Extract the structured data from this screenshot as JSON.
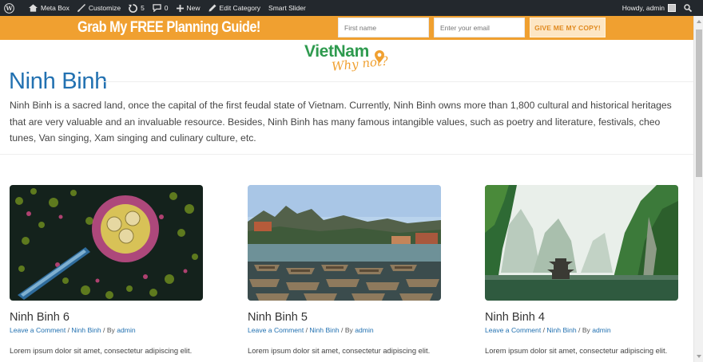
{
  "admin_bar": {
    "site_name": "Meta Box",
    "customize": "Customize",
    "updates_count": "5",
    "comments_count": "0",
    "new": "New",
    "edit_category": "Edit Category",
    "smart_slider": "Smart Slider",
    "howdy": "Howdy, admin"
  },
  "optin": {
    "title": "Grab My FREE Planning Guide!",
    "first_name_placeholder": "First name",
    "email_placeholder": "Enter your email",
    "button_label": "GIVE ME MY COPY!",
    "bg_color": "#f0a030"
  },
  "logo": {
    "main_text": "VietNam",
    "sub_text": "Why not?"
  },
  "category": {
    "title": "Ninh Binh",
    "description": "Ninh Binh is a sacred land, once the capital of the first feudal state of Vietnam. Currently, Ninh Binh owns more than 1,800 cultural and historical heritages that are very valuable and an invaluable resource. Besides, Ninh Binh has many famous intangible values, such as poetry and literature, festivals, cheo tunes, Van singing, Xam singing and culinary culture, etc."
  },
  "posts": [
    {
      "title": "Ninh Binh 6",
      "comment_link": "Leave a Comment",
      "separator1": " / ",
      "category_link": "Ninh Binh",
      "by_text": " / By ",
      "author": "admin",
      "excerpt": "Lorem ipsum dolor sit amet, consectetur adipiscing elit.",
      "image_icon": "lotus-boat-aerial-image"
    },
    {
      "title": "Ninh Binh 5",
      "comment_link": "Leave a Comment",
      "separator1": " / ",
      "category_link": "Ninh Binh",
      "by_text": " / By ",
      "author": "admin",
      "excerpt": "Lorem ipsum dolor sit amet, consectetur adipiscing elit.",
      "image_icon": "river-boats-image"
    },
    {
      "title": "Ninh Binh 4",
      "comment_link": "Leave a Comment",
      "separator1": " / ",
      "category_link": "Ninh Binh",
      "by_text": " / By ",
      "author": "admin",
      "excerpt": "Lorem ipsum dolor sit amet, consectetur adipiscing elit.",
      "image_icon": "karst-pagoda-image"
    }
  ],
  "colors": {
    "link": "#2271b1",
    "brand_green": "#2e9a4e",
    "brand_orange": "#f0a030",
    "admin_bar": "#23282d"
  }
}
